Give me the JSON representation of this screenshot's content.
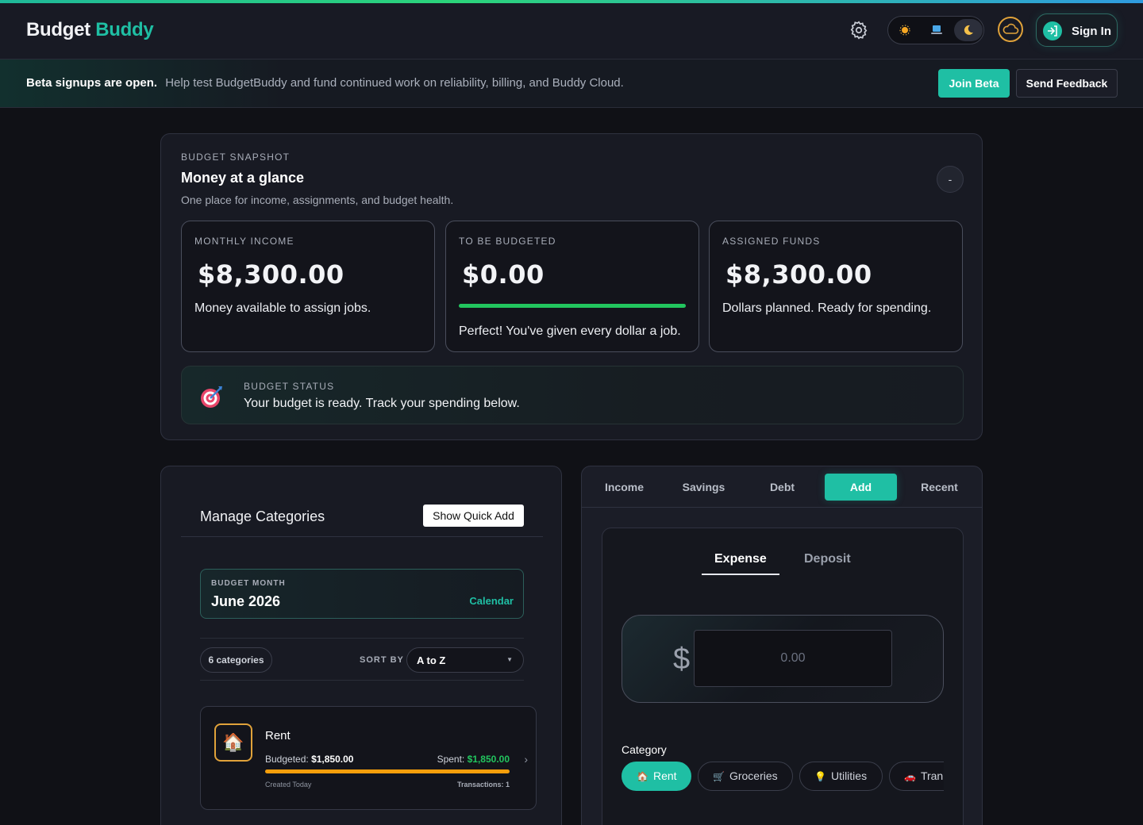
{
  "header": {
    "brand_part1": "Budget",
    "brand_part2": "Buddy",
    "settings_icon": "gear-icon",
    "theme_options": [
      "sun-icon",
      "laptop-icon",
      "moon-icon"
    ],
    "active_theme": "moon-icon",
    "cloud_icon": "cloud-icon",
    "signin_label": "Sign In"
  },
  "banner": {
    "bold": "Beta signups are open.",
    "text": "Help test BudgetBuddy and fund continued work on reliability, billing, and Buddy Cloud.",
    "join_label": "Join Beta",
    "feedback_label": "Send Feedback"
  },
  "snapshot": {
    "eyebrow": "BUDGET SNAPSHOT",
    "title": "Money at a glance",
    "subtitle": "One place for income, assignments, and budget health.",
    "collapse_label": "-",
    "stats": [
      {
        "label": "MONTHLY INCOME",
        "amount": "$8,300.00",
        "desc": "Money available to assign jobs."
      },
      {
        "label": "TO BE BUDGETED",
        "amount": "$0.00",
        "progress": 1.0,
        "desc": "Perfect! You've given every dollar a job."
      },
      {
        "label": "ASSIGNED FUNDS",
        "amount": "$8,300.00",
        "desc": "Dollars planned. Ready for spending."
      }
    ],
    "status": {
      "icon": "target-icon",
      "label": "BUDGET STATUS",
      "message": "Your budget is ready. Track your spending below."
    }
  },
  "manage": {
    "title": "Manage Categories",
    "quick_add_label": "Show Quick Add",
    "month_label": "BUDGET MONTH",
    "month_value": "June 2026",
    "calendar_label": "Calendar",
    "count_label": "6 categories",
    "sort_label": "SORT BY",
    "sort_value": "A to Z",
    "categories": [
      {
        "name": "Rent",
        "icon": "house-icon",
        "budgeted_label": "Budgeted:",
        "budgeted": "$1,850.00",
        "spent_label": "Spent:",
        "spent": "$1,850.00",
        "progress": 1.0,
        "created": "Created Today",
        "transactions": "Transactions: 1"
      }
    ]
  },
  "panel": {
    "tabs": [
      "Income",
      "Savings",
      "Debt",
      "Add",
      "Recent"
    ],
    "active_tab": "Add",
    "subtabs": [
      "Expense",
      "Deposit"
    ],
    "active_subtab": "Expense",
    "currency_symbol": "$",
    "amount_placeholder": "0.00",
    "category_label": "Category",
    "chips": [
      {
        "emoji": "🏠",
        "label": "Rent",
        "active": true
      },
      {
        "emoji": "🛒",
        "label": "Groceries"
      },
      {
        "emoji": "💡",
        "label": "Utilities"
      },
      {
        "emoji": "🚗",
        "label": "Tran"
      }
    ]
  }
}
